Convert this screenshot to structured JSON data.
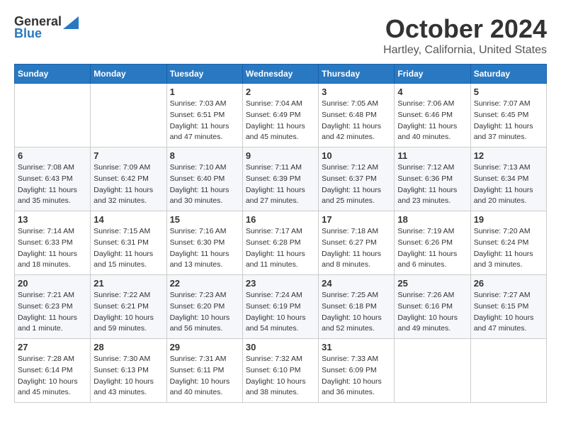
{
  "header": {
    "logo_general": "General",
    "logo_blue": "Blue",
    "month_title": "October 2024",
    "location": "Hartley, California, United States"
  },
  "weekdays": [
    "Sunday",
    "Monday",
    "Tuesday",
    "Wednesday",
    "Thursday",
    "Friday",
    "Saturday"
  ],
  "weeks": [
    [
      {
        "day": "",
        "sunrise": "",
        "sunset": "",
        "daylight": ""
      },
      {
        "day": "",
        "sunrise": "",
        "sunset": "",
        "daylight": ""
      },
      {
        "day": "1",
        "sunrise": "Sunrise: 7:03 AM",
        "sunset": "Sunset: 6:51 PM",
        "daylight": "Daylight: 11 hours and 47 minutes."
      },
      {
        "day": "2",
        "sunrise": "Sunrise: 7:04 AM",
        "sunset": "Sunset: 6:49 PM",
        "daylight": "Daylight: 11 hours and 45 minutes."
      },
      {
        "day": "3",
        "sunrise": "Sunrise: 7:05 AM",
        "sunset": "Sunset: 6:48 PM",
        "daylight": "Daylight: 11 hours and 42 minutes."
      },
      {
        "day": "4",
        "sunrise": "Sunrise: 7:06 AM",
        "sunset": "Sunset: 6:46 PM",
        "daylight": "Daylight: 11 hours and 40 minutes."
      },
      {
        "day": "5",
        "sunrise": "Sunrise: 7:07 AM",
        "sunset": "Sunset: 6:45 PM",
        "daylight": "Daylight: 11 hours and 37 minutes."
      }
    ],
    [
      {
        "day": "6",
        "sunrise": "Sunrise: 7:08 AM",
        "sunset": "Sunset: 6:43 PM",
        "daylight": "Daylight: 11 hours and 35 minutes."
      },
      {
        "day": "7",
        "sunrise": "Sunrise: 7:09 AM",
        "sunset": "Sunset: 6:42 PM",
        "daylight": "Daylight: 11 hours and 32 minutes."
      },
      {
        "day": "8",
        "sunrise": "Sunrise: 7:10 AM",
        "sunset": "Sunset: 6:40 PM",
        "daylight": "Daylight: 11 hours and 30 minutes."
      },
      {
        "day": "9",
        "sunrise": "Sunrise: 7:11 AM",
        "sunset": "Sunset: 6:39 PM",
        "daylight": "Daylight: 11 hours and 27 minutes."
      },
      {
        "day": "10",
        "sunrise": "Sunrise: 7:12 AM",
        "sunset": "Sunset: 6:37 PM",
        "daylight": "Daylight: 11 hours and 25 minutes."
      },
      {
        "day": "11",
        "sunrise": "Sunrise: 7:12 AM",
        "sunset": "Sunset: 6:36 PM",
        "daylight": "Daylight: 11 hours and 23 minutes."
      },
      {
        "day": "12",
        "sunrise": "Sunrise: 7:13 AM",
        "sunset": "Sunset: 6:34 PM",
        "daylight": "Daylight: 11 hours and 20 minutes."
      }
    ],
    [
      {
        "day": "13",
        "sunrise": "Sunrise: 7:14 AM",
        "sunset": "Sunset: 6:33 PM",
        "daylight": "Daylight: 11 hours and 18 minutes."
      },
      {
        "day": "14",
        "sunrise": "Sunrise: 7:15 AM",
        "sunset": "Sunset: 6:31 PM",
        "daylight": "Daylight: 11 hours and 15 minutes."
      },
      {
        "day": "15",
        "sunrise": "Sunrise: 7:16 AM",
        "sunset": "Sunset: 6:30 PM",
        "daylight": "Daylight: 11 hours and 13 minutes."
      },
      {
        "day": "16",
        "sunrise": "Sunrise: 7:17 AM",
        "sunset": "Sunset: 6:28 PM",
        "daylight": "Daylight: 11 hours and 11 minutes."
      },
      {
        "day": "17",
        "sunrise": "Sunrise: 7:18 AM",
        "sunset": "Sunset: 6:27 PM",
        "daylight": "Daylight: 11 hours and 8 minutes."
      },
      {
        "day": "18",
        "sunrise": "Sunrise: 7:19 AM",
        "sunset": "Sunset: 6:26 PM",
        "daylight": "Daylight: 11 hours and 6 minutes."
      },
      {
        "day": "19",
        "sunrise": "Sunrise: 7:20 AM",
        "sunset": "Sunset: 6:24 PM",
        "daylight": "Daylight: 11 hours and 3 minutes."
      }
    ],
    [
      {
        "day": "20",
        "sunrise": "Sunrise: 7:21 AM",
        "sunset": "Sunset: 6:23 PM",
        "daylight": "Daylight: 11 hours and 1 minute."
      },
      {
        "day": "21",
        "sunrise": "Sunrise: 7:22 AM",
        "sunset": "Sunset: 6:21 PM",
        "daylight": "Daylight: 10 hours and 59 minutes."
      },
      {
        "day": "22",
        "sunrise": "Sunrise: 7:23 AM",
        "sunset": "Sunset: 6:20 PM",
        "daylight": "Daylight: 10 hours and 56 minutes."
      },
      {
        "day": "23",
        "sunrise": "Sunrise: 7:24 AM",
        "sunset": "Sunset: 6:19 PM",
        "daylight": "Daylight: 10 hours and 54 minutes."
      },
      {
        "day": "24",
        "sunrise": "Sunrise: 7:25 AM",
        "sunset": "Sunset: 6:18 PM",
        "daylight": "Daylight: 10 hours and 52 minutes."
      },
      {
        "day": "25",
        "sunrise": "Sunrise: 7:26 AM",
        "sunset": "Sunset: 6:16 PM",
        "daylight": "Daylight: 10 hours and 49 minutes."
      },
      {
        "day": "26",
        "sunrise": "Sunrise: 7:27 AM",
        "sunset": "Sunset: 6:15 PM",
        "daylight": "Daylight: 10 hours and 47 minutes."
      }
    ],
    [
      {
        "day": "27",
        "sunrise": "Sunrise: 7:28 AM",
        "sunset": "Sunset: 6:14 PM",
        "daylight": "Daylight: 10 hours and 45 minutes."
      },
      {
        "day": "28",
        "sunrise": "Sunrise: 7:30 AM",
        "sunset": "Sunset: 6:13 PM",
        "daylight": "Daylight: 10 hours and 43 minutes."
      },
      {
        "day": "29",
        "sunrise": "Sunrise: 7:31 AM",
        "sunset": "Sunset: 6:11 PM",
        "daylight": "Daylight: 10 hours and 40 minutes."
      },
      {
        "day": "30",
        "sunrise": "Sunrise: 7:32 AM",
        "sunset": "Sunset: 6:10 PM",
        "daylight": "Daylight: 10 hours and 38 minutes."
      },
      {
        "day": "31",
        "sunrise": "Sunrise: 7:33 AM",
        "sunset": "Sunset: 6:09 PM",
        "daylight": "Daylight: 10 hours and 36 minutes."
      },
      {
        "day": "",
        "sunrise": "",
        "sunset": "",
        "daylight": ""
      },
      {
        "day": "",
        "sunrise": "",
        "sunset": "",
        "daylight": ""
      }
    ]
  ]
}
